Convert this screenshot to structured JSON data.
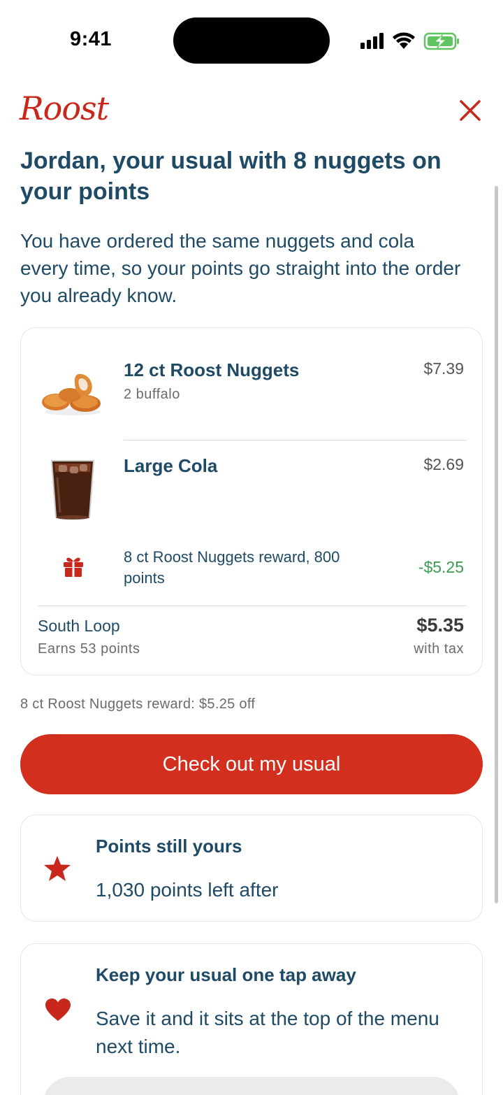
{
  "status_bar": {
    "time": "9:41"
  },
  "header": {
    "logo_text": "Roost"
  },
  "headline": "Jordan, your usual with 8 nuggets on your points",
  "intro": "You have ordered the same nuggets and cola every time, so your points go straight into the order you already know.",
  "order": {
    "items": [
      {
        "name": "12 ct Roost Nuggets",
        "detail": "2 buffalo",
        "price": "$7.39",
        "icon": "nuggets-image"
      },
      {
        "name": "Large Cola",
        "detail": "",
        "price": "$2.69",
        "icon": "cola-image"
      }
    ],
    "reward": {
      "label": "8 ct Roost Nuggets reward, 800 points",
      "amount": "-$5.25",
      "icon": "gift-icon"
    },
    "store": "South Loop",
    "earns": "Earns 53 points",
    "total": "$5.35",
    "total_note": "with tax"
  },
  "reward_note": "8 ct Roost Nuggets reward: $5.25 off",
  "checkout_label": "Check out my usual",
  "points_card": {
    "title": "Points still yours",
    "body": "1,030 points left after",
    "icon": "star-icon"
  },
  "save_card": {
    "title": "Keep your usual one tap away",
    "body": "Save it and it sits at the top of the menu next time.",
    "icon": "heart-icon"
  },
  "colors": {
    "brand_red": "#d22f1e",
    "text_navy": "#1f4a66",
    "discount_green": "#3c9b53"
  }
}
